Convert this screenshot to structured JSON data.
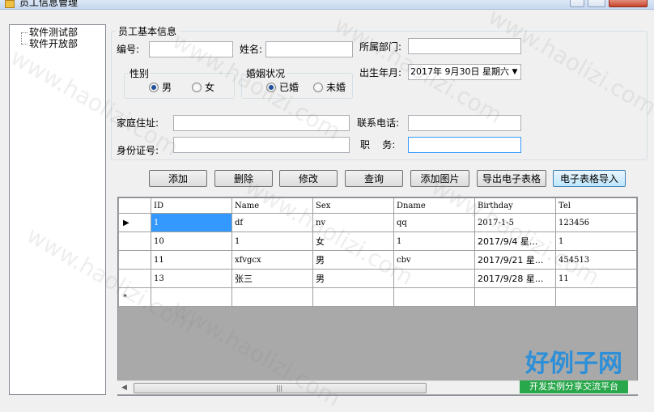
{
  "window": {
    "title": "员工信息管理"
  },
  "tree": {
    "items": [
      "软件测试部",
      "软件开放部"
    ]
  },
  "form": {
    "group_title": "员工基本信息",
    "id_label": "编号:",
    "name_label": "姓名:",
    "dept_label": "所属部门:",
    "gender": {
      "title": "性别",
      "options": [
        "男",
        "女"
      ],
      "selected": "男"
    },
    "marital": {
      "title": "婚姻状况",
      "options": [
        "已婚",
        "未婚"
      ],
      "selected": "已婚"
    },
    "birth_label": "出生年月:",
    "birth_value": "2017年  9月30日  星期六",
    "address_label": "家庭住址:",
    "phone_label": "联系电话:",
    "idcard_label": "身份证号:",
    "job_label": "职    务:",
    "id_value": "",
    "name_value": "",
    "dept_value": "",
    "address_value": "",
    "phone_value": "",
    "idcard_value": "",
    "job_value": ""
  },
  "buttons": [
    "添加",
    "删除",
    "修改",
    "查询",
    "添加图片",
    "导出电子表格",
    "电子表格导入"
  ],
  "grid": {
    "columns": [
      "ID",
      "Name",
      "Sex",
      "Dname",
      "Birthday",
      "Tel"
    ],
    "rows": [
      [
        "1",
        "df",
        "nv",
        "qq",
        "2017-1-5",
        "123456"
      ],
      [
        "10",
        "1",
        "女",
        "1",
        "2017/9/4 星...",
        "1"
      ],
      [
        "11",
        "xfvgcx",
        "男",
        "cbv",
        "2017/9/21 星...",
        "454513"
      ],
      [
        "13",
        "张三",
        "男",
        "",
        "2017/9/28 星...",
        "11"
      ]
    ],
    "current_row_marker": "▶",
    "new_row_marker": "*"
  },
  "watermark": {
    "text": "www.haolizi.com",
    "brand": "好例子网",
    "brand_sub": "开发实例分享交流平台"
  }
}
